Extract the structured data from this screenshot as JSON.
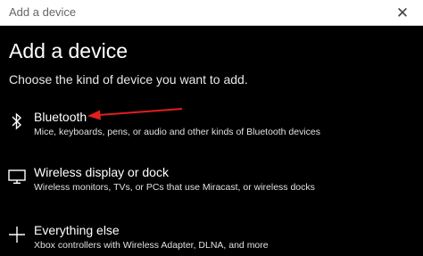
{
  "window": {
    "title": "Add a device",
    "close_glyph": "✕"
  },
  "main": {
    "heading": "Add a device",
    "subheading": "Choose the kind of device you want to add."
  },
  "options": [
    {
      "icon": "bluetooth-icon",
      "title": "Bluetooth",
      "description": "Mice, keyboards, pens, or audio and other kinds of Bluetooth devices"
    },
    {
      "icon": "monitor-icon",
      "title": "Wireless display or dock",
      "description": "Wireless monitors, TVs, or PCs that use Miracast, or wireless docks"
    },
    {
      "icon": "plus-icon",
      "title": "Everything else",
      "description": "Xbox controllers with Wireless Adapter, DLNA, and more"
    }
  ],
  "annotation": {
    "arrow_color": "#e0201c"
  }
}
